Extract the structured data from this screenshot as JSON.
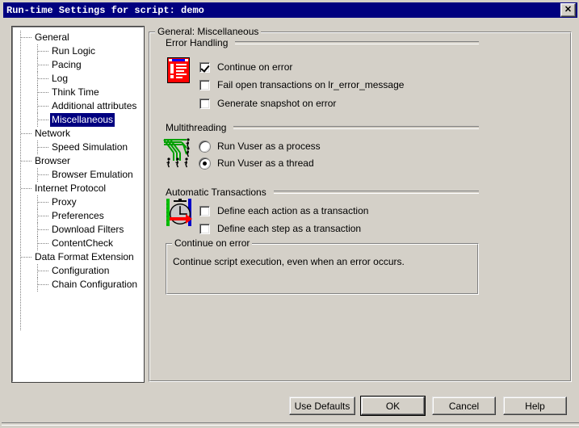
{
  "window": {
    "title": "Run-time Settings for script: demo",
    "close_label": "✕",
    "close_icon": "close-icon"
  },
  "tree": {
    "nodes": [
      {
        "label": "General",
        "level": 1,
        "selected": false
      },
      {
        "label": "Run Logic",
        "level": 2,
        "selected": false
      },
      {
        "label": "Pacing",
        "level": 2,
        "selected": false
      },
      {
        "label": "Log",
        "level": 2,
        "selected": false
      },
      {
        "label": "Think Time",
        "level": 2,
        "selected": false
      },
      {
        "label": "Additional attributes",
        "level": 2,
        "selected": false
      },
      {
        "label": "Miscellaneous",
        "level": 2,
        "selected": true
      },
      {
        "label": "Network",
        "level": 1,
        "selected": false
      },
      {
        "label": "Speed Simulation",
        "level": 2,
        "selected": false
      },
      {
        "label": "Browser",
        "level": 1,
        "selected": false
      },
      {
        "label": "Browser Emulation",
        "level": 2,
        "selected": false
      },
      {
        "label": "Internet Protocol",
        "level": 1,
        "selected": false
      },
      {
        "label": "Proxy",
        "level": 2,
        "selected": false
      },
      {
        "label": "Preferences",
        "level": 2,
        "selected": false
      },
      {
        "label": "Download Filters",
        "level": 2,
        "selected": false
      },
      {
        "label": "ContentCheck",
        "level": 2,
        "selected": false
      },
      {
        "label": "Data Format Extension",
        "level": 1,
        "selected": false
      },
      {
        "label": "Configuration",
        "level": 2,
        "selected": false
      },
      {
        "label": "Chain Configuration",
        "level": 2,
        "selected": false
      }
    ]
  },
  "panel": {
    "caption": "General: Miscellaneous",
    "error_handling": {
      "title": "Error Handling",
      "icon": "error-document-icon",
      "options": [
        {
          "label": "Continue on error",
          "checked": true
        },
        {
          "label": "Fail open transactions on lr_error_message",
          "checked": false
        },
        {
          "label": "Generate snapshot on error",
          "checked": false
        }
      ]
    },
    "multithreading": {
      "title": "Multithreading",
      "icon": "threads-runners-icon",
      "options": [
        {
          "label": "Run Vuser as a process",
          "selected": false
        },
        {
          "label": "Run Vuser as a thread",
          "selected": true
        }
      ]
    },
    "automatic_transactions": {
      "title": "Automatic Transactions",
      "icon": "stopwatch-arrow-icon",
      "options": [
        {
          "label": "Define each action as a transaction",
          "checked": false
        },
        {
          "label": "Define each step as a transaction",
          "checked": false
        }
      ]
    },
    "description": {
      "caption": "Continue on error",
      "text": "Continue script execution, even when an error occurs."
    }
  },
  "buttons": {
    "use_defaults": "Use Defaults",
    "ok": "OK",
    "cancel": "Cancel",
    "help": "Help"
  },
  "colors": {
    "face": "#d4d0c8",
    "title_bar": "#00007f",
    "selection": "#000080",
    "icon_red": "#ff0000",
    "icon_green": "#00c000",
    "icon_blue": "#0000ff"
  }
}
